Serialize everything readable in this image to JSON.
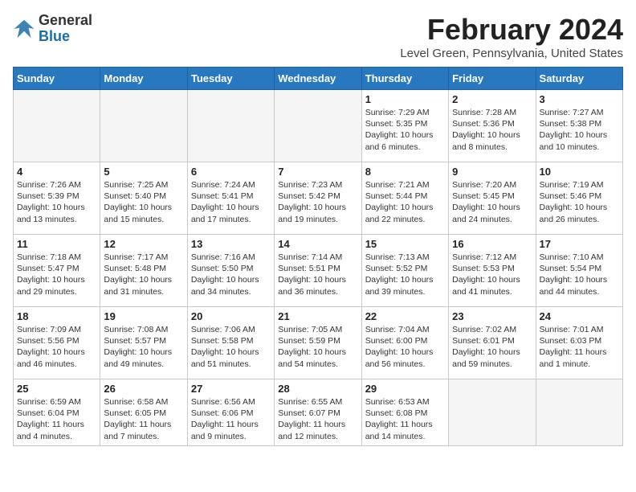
{
  "header": {
    "logo_general": "General",
    "logo_blue": "Blue",
    "title": "February 2024",
    "subtitle": "Level Green, Pennsylvania, United States"
  },
  "weekdays": [
    "Sunday",
    "Monday",
    "Tuesday",
    "Wednesday",
    "Thursday",
    "Friday",
    "Saturday"
  ],
  "weeks": [
    [
      {
        "day": "",
        "info": "",
        "empty": true
      },
      {
        "day": "",
        "info": "",
        "empty": true
      },
      {
        "day": "",
        "info": "",
        "empty": true
      },
      {
        "day": "",
        "info": "",
        "empty": true
      },
      {
        "day": "1",
        "info": "Sunrise: 7:29 AM\nSunset: 5:35 PM\nDaylight: 10 hours\nand 6 minutes.",
        "empty": false
      },
      {
        "day": "2",
        "info": "Sunrise: 7:28 AM\nSunset: 5:36 PM\nDaylight: 10 hours\nand 8 minutes.",
        "empty": false
      },
      {
        "day": "3",
        "info": "Sunrise: 7:27 AM\nSunset: 5:38 PM\nDaylight: 10 hours\nand 10 minutes.",
        "empty": false
      }
    ],
    [
      {
        "day": "4",
        "info": "Sunrise: 7:26 AM\nSunset: 5:39 PM\nDaylight: 10 hours\nand 13 minutes.",
        "empty": false
      },
      {
        "day": "5",
        "info": "Sunrise: 7:25 AM\nSunset: 5:40 PM\nDaylight: 10 hours\nand 15 minutes.",
        "empty": false
      },
      {
        "day": "6",
        "info": "Sunrise: 7:24 AM\nSunset: 5:41 PM\nDaylight: 10 hours\nand 17 minutes.",
        "empty": false
      },
      {
        "day": "7",
        "info": "Sunrise: 7:23 AM\nSunset: 5:42 PM\nDaylight: 10 hours\nand 19 minutes.",
        "empty": false
      },
      {
        "day": "8",
        "info": "Sunrise: 7:21 AM\nSunset: 5:44 PM\nDaylight: 10 hours\nand 22 minutes.",
        "empty": false
      },
      {
        "day": "9",
        "info": "Sunrise: 7:20 AM\nSunset: 5:45 PM\nDaylight: 10 hours\nand 24 minutes.",
        "empty": false
      },
      {
        "day": "10",
        "info": "Sunrise: 7:19 AM\nSunset: 5:46 PM\nDaylight: 10 hours\nand 26 minutes.",
        "empty": false
      }
    ],
    [
      {
        "day": "11",
        "info": "Sunrise: 7:18 AM\nSunset: 5:47 PM\nDaylight: 10 hours\nand 29 minutes.",
        "empty": false
      },
      {
        "day": "12",
        "info": "Sunrise: 7:17 AM\nSunset: 5:48 PM\nDaylight: 10 hours\nand 31 minutes.",
        "empty": false
      },
      {
        "day": "13",
        "info": "Sunrise: 7:16 AM\nSunset: 5:50 PM\nDaylight: 10 hours\nand 34 minutes.",
        "empty": false
      },
      {
        "day": "14",
        "info": "Sunrise: 7:14 AM\nSunset: 5:51 PM\nDaylight: 10 hours\nand 36 minutes.",
        "empty": false
      },
      {
        "day": "15",
        "info": "Sunrise: 7:13 AM\nSunset: 5:52 PM\nDaylight: 10 hours\nand 39 minutes.",
        "empty": false
      },
      {
        "day": "16",
        "info": "Sunrise: 7:12 AM\nSunset: 5:53 PM\nDaylight: 10 hours\nand 41 minutes.",
        "empty": false
      },
      {
        "day": "17",
        "info": "Sunrise: 7:10 AM\nSunset: 5:54 PM\nDaylight: 10 hours\nand 44 minutes.",
        "empty": false
      }
    ],
    [
      {
        "day": "18",
        "info": "Sunrise: 7:09 AM\nSunset: 5:56 PM\nDaylight: 10 hours\nand 46 minutes.",
        "empty": false
      },
      {
        "day": "19",
        "info": "Sunrise: 7:08 AM\nSunset: 5:57 PM\nDaylight: 10 hours\nand 49 minutes.",
        "empty": false
      },
      {
        "day": "20",
        "info": "Sunrise: 7:06 AM\nSunset: 5:58 PM\nDaylight: 10 hours\nand 51 minutes.",
        "empty": false
      },
      {
        "day": "21",
        "info": "Sunrise: 7:05 AM\nSunset: 5:59 PM\nDaylight: 10 hours\nand 54 minutes.",
        "empty": false
      },
      {
        "day": "22",
        "info": "Sunrise: 7:04 AM\nSunset: 6:00 PM\nDaylight: 10 hours\nand 56 minutes.",
        "empty": false
      },
      {
        "day": "23",
        "info": "Sunrise: 7:02 AM\nSunset: 6:01 PM\nDaylight: 10 hours\nand 59 minutes.",
        "empty": false
      },
      {
        "day": "24",
        "info": "Sunrise: 7:01 AM\nSunset: 6:03 PM\nDaylight: 11 hours\nand 1 minute.",
        "empty": false
      }
    ],
    [
      {
        "day": "25",
        "info": "Sunrise: 6:59 AM\nSunset: 6:04 PM\nDaylight: 11 hours\nand 4 minutes.",
        "empty": false
      },
      {
        "day": "26",
        "info": "Sunrise: 6:58 AM\nSunset: 6:05 PM\nDaylight: 11 hours\nand 7 minutes.",
        "empty": false
      },
      {
        "day": "27",
        "info": "Sunrise: 6:56 AM\nSunset: 6:06 PM\nDaylight: 11 hours\nand 9 minutes.",
        "empty": false
      },
      {
        "day": "28",
        "info": "Sunrise: 6:55 AM\nSunset: 6:07 PM\nDaylight: 11 hours\nand 12 minutes.",
        "empty": false
      },
      {
        "day": "29",
        "info": "Sunrise: 6:53 AM\nSunset: 6:08 PM\nDaylight: 11 hours\nand 14 minutes.",
        "empty": false
      },
      {
        "day": "",
        "info": "",
        "empty": true
      },
      {
        "day": "",
        "info": "",
        "empty": true
      }
    ]
  ]
}
